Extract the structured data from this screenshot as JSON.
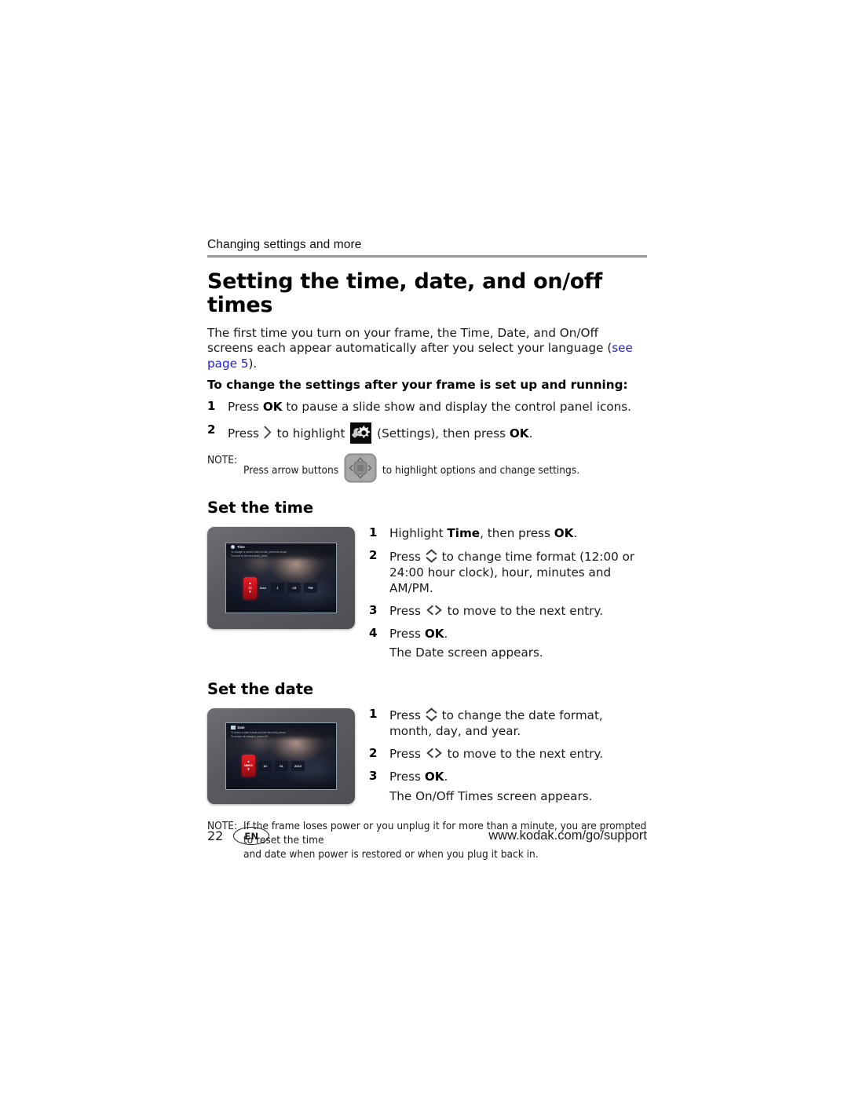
{
  "header": {
    "running_head": "Changing settings and more"
  },
  "title": "Setting the time, date, and on/off times",
  "intro": {
    "text_before_link": "The first time you turn on your frame, the Time, Date, and On/Off screens each appear automatically after you select your language (",
    "link_text": "see page",
    "link_page": "5",
    "text_after_link": ")."
  },
  "lead_bold": "To change the settings after your frame is set up and running:",
  "main_steps": [
    {
      "num": "1",
      "parts": [
        "Press ",
        "OK",
        " to pause a slide show and display the control panel icons."
      ]
    },
    {
      "num": "2",
      "before_arrow": "Press ",
      "after_arrow": " to highlight ",
      "after_icon": " (Settings), then press ",
      "bold_ok": "OK",
      "end": "."
    }
  ],
  "note_arrow": {
    "label": "NOTE:",
    "before_icon": "Press arrow buttons",
    "after_icon": "to highlight options and change settings."
  },
  "set_time": {
    "heading": "Set the time",
    "steps": [
      {
        "num": "1",
        "a": "Highlight ",
        "bold1": "Time",
        "b": ", then press ",
        "bold2": "OK",
        "c": "."
      },
      {
        "num": "2",
        "a": "Press ",
        "icon": "chevron-up-down",
        "b": " to change time format (12:00 or 24:00 hour clock), hour, minutes and AM/PM."
      },
      {
        "num": "3",
        "a": "Press ",
        "icon": "chevron-left-right",
        "b": " to move to the next entry."
      },
      {
        "num": "4",
        "a": "Press ",
        "bold1": "OK",
        "c": ".",
        "sub": "The Date screen appears."
      }
    ],
    "device": {
      "screen_title": "Time",
      "help_line1": "To change a current field format, press the arrow",
      "help_line2": "To move to the next entry, press",
      "selector_value": "12",
      "selector_label": "hour",
      "fields": [
        "1",
        ":15",
        "PM"
      ]
    }
  },
  "set_date": {
    "heading": "Set the date",
    "steps": [
      {
        "num": "1",
        "a": "Press ",
        "icon": "chevron-up-down",
        "b": " to change the date format, month, day, and year."
      },
      {
        "num": "2",
        "a": "Press ",
        "icon": "chevron-left-right",
        "b": " to move to the next entry."
      },
      {
        "num": "3",
        "a": "Press ",
        "bold1": "OK",
        "c": ".",
        "sub": "The On/Off Times screen appears."
      }
    ],
    "device": {
      "screen_title": "Date",
      "help_line1": "To select a date format and the first entry, press",
      "help_line2": "To accept all changes, press OK",
      "selector_value": "MM/DD",
      "fields": [
        "10",
        "01",
        "2010"
      ]
    }
  },
  "note_power": {
    "label": "NOTE:",
    "line1": "If the frame loses power or you unplug it for more than a minute, you are prompted to reset the time",
    "line2": "and date when power is restored or when you plug it back in."
  },
  "footer": {
    "page_number": "22",
    "language": "EN",
    "url": "www.kodak.com/go/support"
  },
  "colors": {
    "link": "#2222dd",
    "rule": "#9a9a9a",
    "frame_bezel": "#5a5a5f",
    "selector_red": "#c2121b"
  }
}
